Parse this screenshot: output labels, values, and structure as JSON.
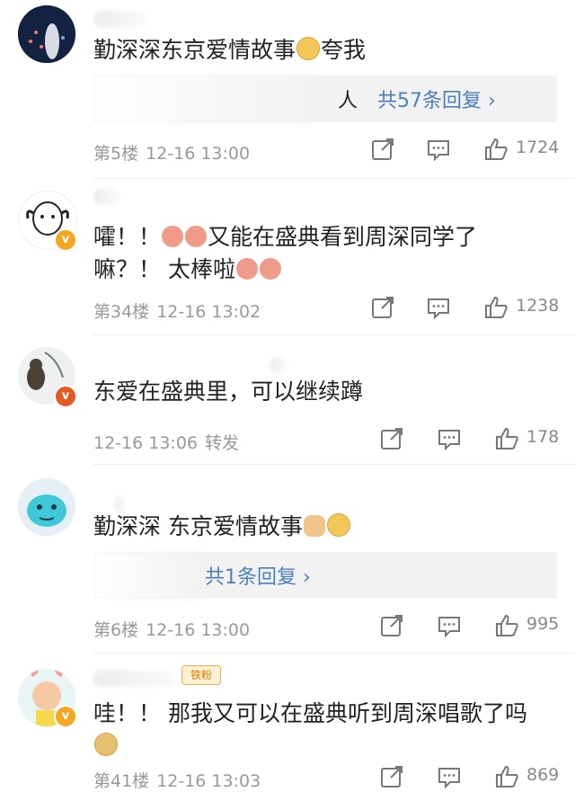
{
  "comments": [
    {
      "text": "勤深深东京爱情故事",
      "text_suffix": "夸我",
      "reply_people": "人",
      "reply_more": "共57条回复 ›",
      "meta_floor": "第5楼",
      "meta_time": "12-16 13:00",
      "likes": "1724",
      "verified": false
    },
    {
      "text_line1_a": "嚯！！",
      "text_line1_b": "又能在盛典看到周深同学了",
      "text_line2_a": "嘛？！ 太棒啦",
      "meta_floor": "第34楼",
      "meta_time": "12-16 13:02",
      "likes": "1238",
      "verified": true
    },
    {
      "text": "东爱在盛典里，可以继续蹲",
      "meta_time": "12-16 13:06",
      "meta_extra": "转发",
      "likes": "178",
      "verified": true
    },
    {
      "text": "勤深深 东京爱情故事",
      "reply_more": "共1条回复 ›",
      "meta_floor": "第6楼",
      "meta_time": "12-16 13:00",
      "likes": "995",
      "verified": false
    },
    {
      "fan_badge": "铁粉",
      "text": "哇！！ 那我又可以在盛典听到周深唱歌了吗",
      "meta_floor": "第41楼",
      "meta_time": "12-16 13:03",
      "likes": "869",
      "verified": true
    }
  ],
  "colors": {
    "link": "#4a7fc0",
    "meta": "#999999",
    "badge": "#f5a623"
  },
  "icons": [
    "share-icon",
    "comment-icon",
    "like-icon",
    "verified-badge-icon",
    "emoji-icon"
  ]
}
